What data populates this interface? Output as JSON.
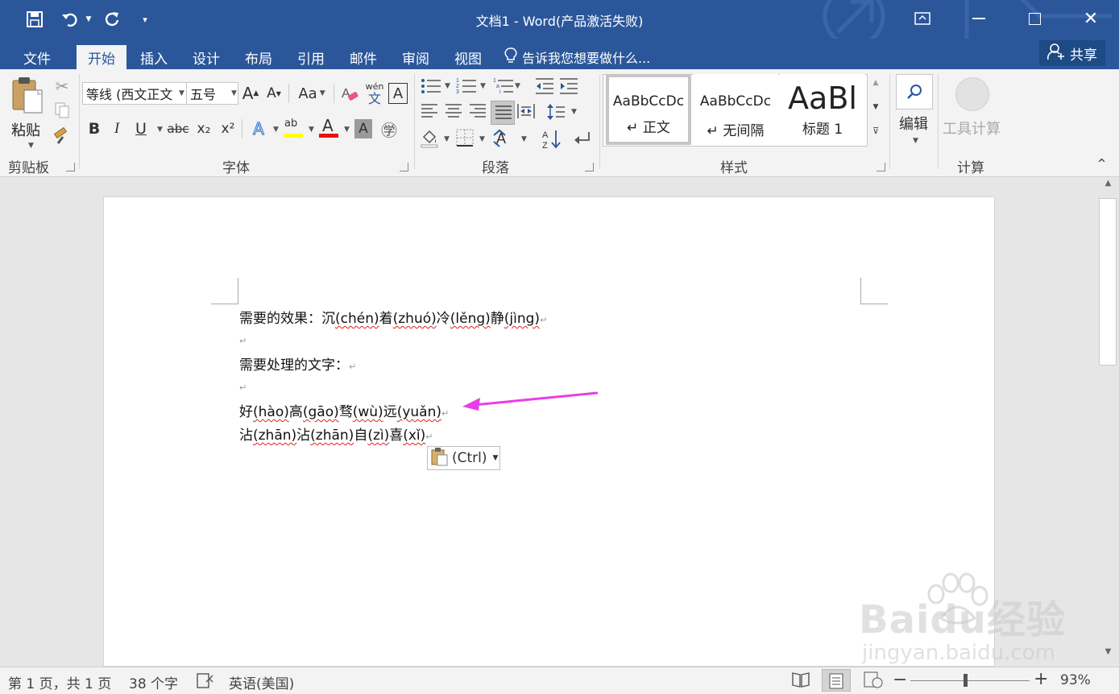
{
  "titlebar": {
    "title": "文档1 - Word(产品激活失败)"
  },
  "tabs": [
    "文件",
    "开始",
    "插入",
    "设计",
    "布局",
    "引用",
    "邮件",
    "审阅",
    "视图"
  ],
  "tellme": "告诉我您想要做什么...",
  "share": "共享",
  "ribbon": {
    "clipboard": {
      "paste": "粘贴",
      "group": "剪贴板"
    },
    "font": {
      "name": "等线 (西文正文",
      "size": "五号",
      "group": "字体",
      "case": "Aa",
      "phonetic_top": "wén",
      "phonetic_bottom": "文",
      "bold": "B",
      "italic": "I",
      "underline": "U",
      "strike": "abc",
      "subscript": "x₂",
      "superscript": "x²",
      "char_shading": "A",
      "enclose": "㊫",
      "effects": "A",
      "highlight": "ab",
      "fontcolor": "A",
      "grow": "A",
      "shrink": "A",
      "clear": "A"
    },
    "paragraph": {
      "group": "段落"
    },
    "styles": {
      "group": "样式",
      "items": [
        {
          "preview": "AaBbCcDc",
          "name": "↵ 正文"
        },
        {
          "preview": "AaBbCcDc",
          "name": "↵ 无间隔"
        },
        {
          "preview": "AaBl",
          "name": "标题 1"
        }
      ]
    },
    "editing": {
      "label": "编辑"
    },
    "calc": {
      "label": "工具计算",
      "group": "计算"
    }
  },
  "document": {
    "line1": {
      "prefix": "需要的效果：",
      "segments": [
        {
          "t": "沉",
          "w": false
        },
        {
          "t": "(chén)",
          "w": true
        },
        {
          "t": "着",
          "w": false
        },
        {
          "t": "(zhuó)",
          "w": true
        },
        {
          "t": "冷",
          "w": false
        },
        {
          "t": "(lěng)",
          "w": true
        },
        {
          "t": "静",
          "w": false
        },
        {
          "t": "(jìng)",
          "w": true
        }
      ]
    },
    "line3": "需要处理的文字：",
    "line5": {
      "segments": [
        {
          "t": "好",
          "w": false
        },
        {
          "t": "(hào)",
          "w": true
        },
        {
          "t": "高",
          "w": false
        },
        {
          "t": "(gāo)",
          "w": true
        },
        {
          "t": "骛",
          "w": false
        },
        {
          "t": "(wù)",
          "w": true
        },
        {
          "t": "远",
          "w": false
        },
        {
          "t": "(yuǎn)",
          "w": true
        }
      ]
    },
    "line6": {
      "segments": [
        {
          "t": "沾",
          "w": false
        },
        {
          "t": "(zhān)",
          "w": true
        },
        {
          "t": "沾",
          "w": false
        },
        {
          "t": "(zhān)",
          "w": true
        },
        {
          "t": "自",
          "w": false
        },
        {
          "t": "(zì)",
          "w": true
        },
        {
          "t": "喜",
          "w": false
        },
        {
          "t": "(xǐ)",
          "w": true
        }
      ]
    },
    "para_mark": "↵",
    "paste_options": "(Ctrl)",
    "arrow_color": "#e83ee8"
  },
  "status": {
    "page": "第 1 页，共 1 页",
    "words": "38 个字",
    "language": "英语(美国)",
    "zoom": "93%",
    "zoom_minus": "−",
    "zoom_plus": "+"
  },
  "watermark": {
    "text": "Baidu经验",
    "url": "jingyan.baidu.com"
  }
}
